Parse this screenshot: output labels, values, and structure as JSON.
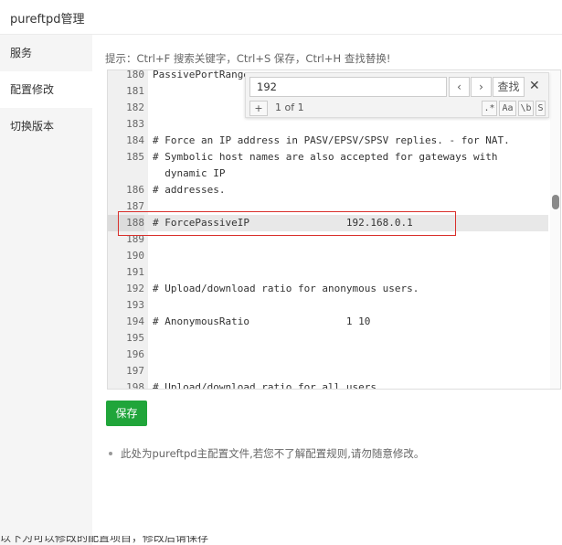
{
  "window": {
    "title": "pureftpd管理"
  },
  "sidebar": {
    "items": [
      {
        "label": "服务",
        "active": false
      },
      {
        "label": "配置修改",
        "active": true
      },
      {
        "label": "切换版本",
        "active": false
      }
    ]
  },
  "hint": "提示：Ctrl+F 搜索关键字，Ctrl+S 保存，Ctrl+H 查找替换!",
  "editor": {
    "current_line": "188",
    "lines": [
      {
        "n": "180",
        "text": "PassivePortRange"
      },
      {
        "n": "181",
        "text": ""
      },
      {
        "n": "182",
        "text": ""
      },
      {
        "n": "183",
        "text": ""
      },
      {
        "n": "184",
        "text": "# Force an IP address in PASV/EPSV/SPSV replies. - for NAT."
      },
      {
        "n": "185",
        "text": "# Symbolic host names are also accepted for gateways with\n  dynamic IP"
      },
      {
        "n": "186",
        "text": "# addresses."
      },
      {
        "n": "187",
        "text": ""
      },
      {
        "n": "188",
        "text": "# ForcePassiveIP                192.168.0.1"
      },
      {
        "n": "189",
        "text": ""
      },
      {
        "n": "190",
        "text": ""
      },
      {
        "n": "191",
        "text": ""
      },
      {
        "n": "192",
        "text": "# Upload/download ratio for anonymous users."
      },
      {
        "n": "193",
        "text": ""
      },
      {
        "n": "194",
        "text": "# AnonymousRatio                1 10"
      },
      {
        "n": "195",
        "text": ""
      },
      {
        "n": "196",
        "text": ""
      },
      {
        "n": "197",
        "text": ""
      },
      {
        "n": "198",
        "text": "# Upload/download ratio for all users."
      }
    ]
  },
  "search": {
    "query": "192",
    "prev": "‹",
    "next": "›",
    "find_label": "查找",
    "close": "✕",
    "expand": "+",
    "count": "1 of 1",
    "opt_regex": ".*",
    "opt_case": "Aa",
    "opt_word": "\\b",
    "opt_selection": "S"
  },
  "save_label": "保存",
  "notes": [
    "此处为pureftpd主配置文件,若您不了解配置规则,请勿随意修改。"
  ],
  "bottom_clipped_text": "以下为可以修改的配置项目，修改后请保存"
}
